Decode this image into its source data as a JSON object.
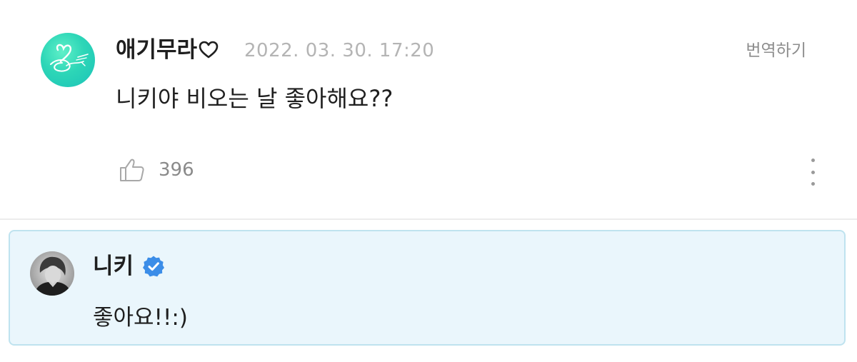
{
  "comment": {
    "author": "애기무라",
    "author_icon": "heart-outline-icon",
    "timestamp": "2022. 03. 30. 17:20",
    "translate_label": "번역하기",
    "text": "니키야 비오는 날 좋아해요??",
    "likes": "396",
    "avatar_color": "#2dd6b7"
  },
  "reply": {
    "author": "니키",
    "verified_icon": "verified-badge-icon",
    "verified_color": "#3b8de8",
    "text": "좋아요!!:)",
    "background_color": "#eaf6fc",
    "border_color": "#bfe3ef"
  }
}
